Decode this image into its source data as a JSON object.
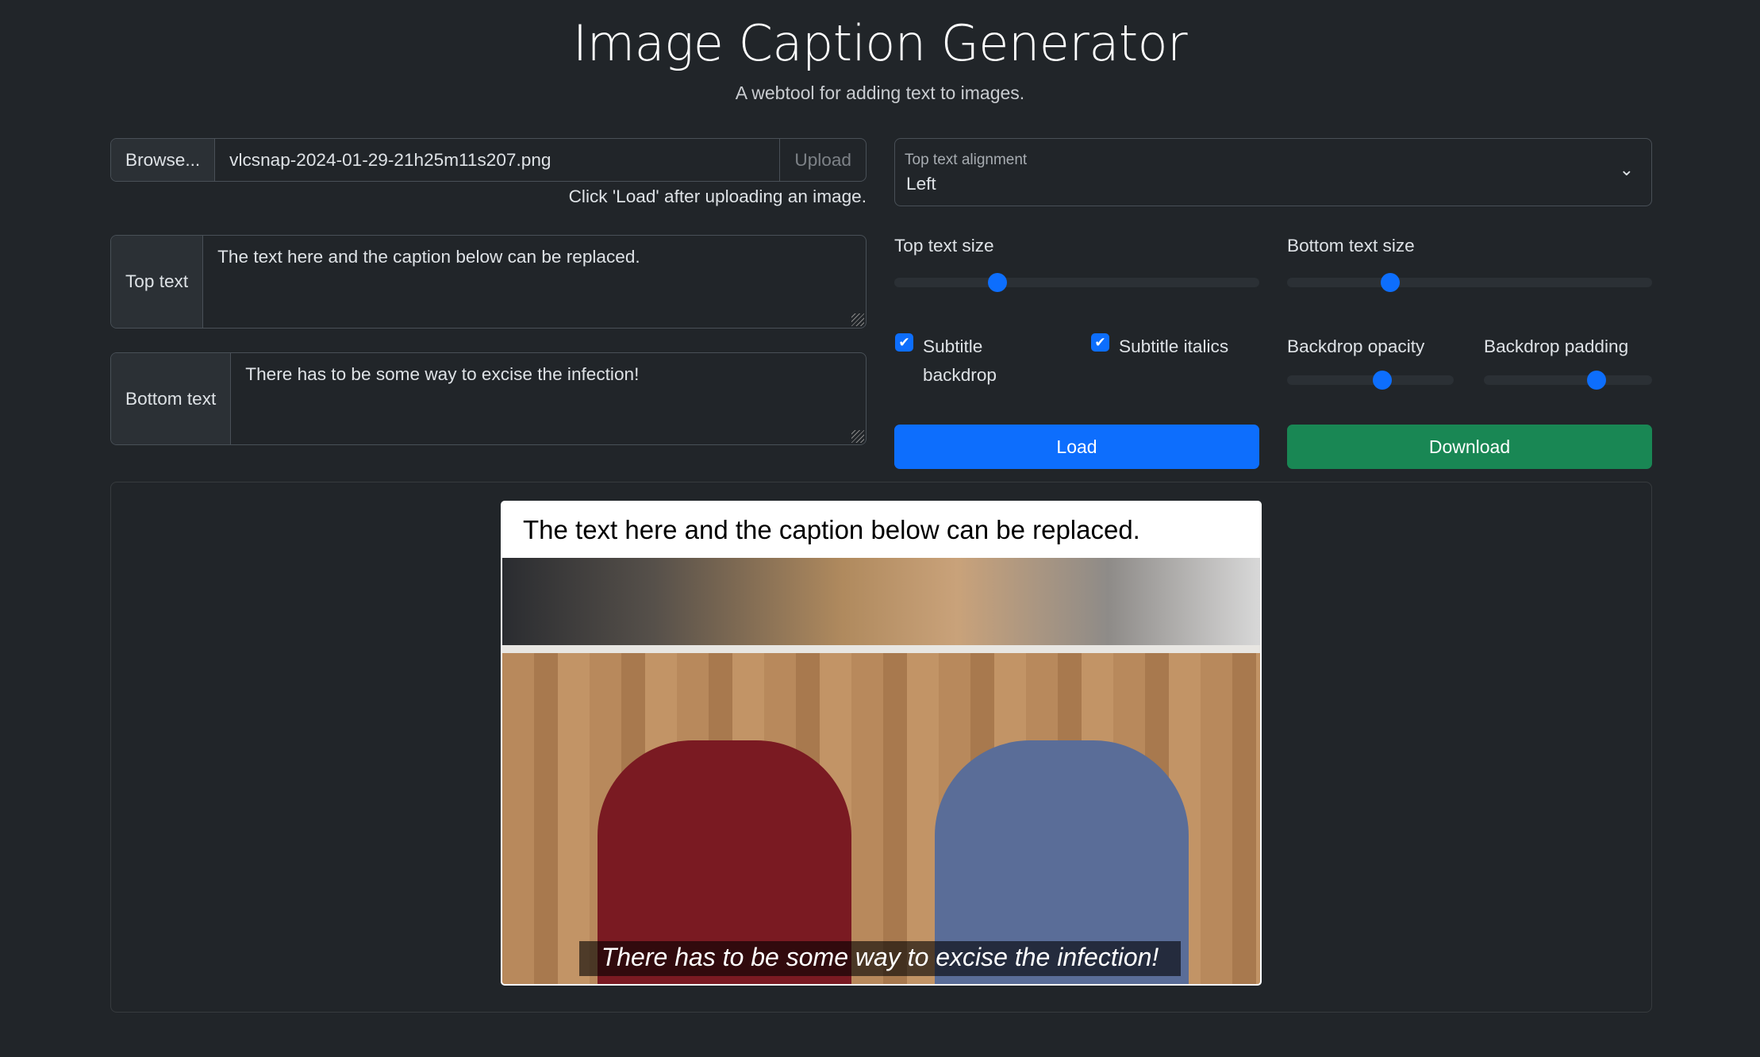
{
  "header": {
    "title": "Image Caption Generator",
    "subtitle": "A webtool for adding text to images."
  },
  "file": {
    "browse_label": "Browse...",
    "filename": "vlcsnap-2024-01-29-21h25m11s207.png",
    "upload_label": "Upload",
    "hint": "Click 'Load' after uploading an image."
  },
  "top_text": {
    "label": "Top text",
    "value": "The text here and the caption below can be replaced."
  },
  "bottom_text": {
    "label": "Bottom text",
    "value": "There has to be some way to excise the infection!"
  },
  "alignment": {
    "label": "Top text alignment",
    "value": "Left"
  },
  "sliders": {
    "top_size": {
      "label": "Top text size",
      "percent": 27
    },
    "bottom_size": {
      "label": "Bottom text size",
      "percent": 27
    },
    "opacity": {
      "label": "Backdrop opacity",
      "percent": 58
    },
    "padding": {
      "label": "Backdrop padding",
      "percent": 69
    }
  },
  "checkboxes": {
    "backdrop": {
      "label": "Subtitle backdrop",
      "checked": true
    },
    "italics": {
      "label": "Subtitle italics",
      "checked": true
    }
  },
  "buttons": {
    "load": "Load",
    "download": "Download"
  },
  "colors": {
    "primary": "#0d6efd",
    "success": "#198754",
    "background": "#212529"
  },
  "preview": {
    "top_caption": "The text here and the caption below can be replaced.",
    "bottom_caption": "There has to be some way to excise the infection!"
  }
}
